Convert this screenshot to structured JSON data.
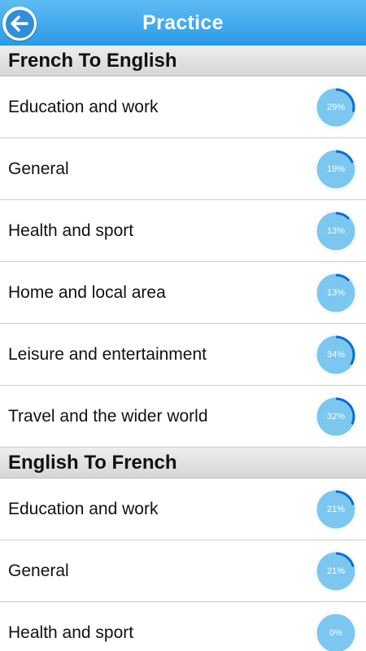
{
  "header": {
    "title": "Practice",
    "back_icon": "back-arrow-icon"
  },
  "colors": {
    "header_top": "#5fbcf5",
    "header_bottom": "#2a9ae6",
    "ring_light": "#7cc7f0",
    "ring_dark": "#0b6fd0"
  },
  "sections": [
    {
      "title": "French To English",
      "items": [
        {
          "label": "Education and work",
          "progress_text": "29%",
          "progress": 29
        },
        {
          "label": "General",
          "progress_text": "19%",
          "progress": 19
        },
        {
          "label": "Health and sport",
          "progress_text": "13%",
          "progress": 13
        },
        {
          "label": "Home and local area",
          "progress_text": "13%",
          "progress": 13
        },
        {
          "label": "Leisure and entertainment",
          "progress_text": "34%",
          "progress": 34
        },
        {
          "label": "Travel and the wider world",
          "progress_text": "32%",
          "progress": 32
        }
      ]
    },
    {
      "title": "English To French",
      "items": [
        {
          "label": "Education and work",
          "progress_text": "21%",
          "progress": 21
        },
        {
          "label": "General",
          "progress_text": "21%",
          "progress": 21
        },
        {
          "label": "Health and sport",
          "progress_text": "0%",
          "progress": 0
        }
      ]
    }
  ]
}
